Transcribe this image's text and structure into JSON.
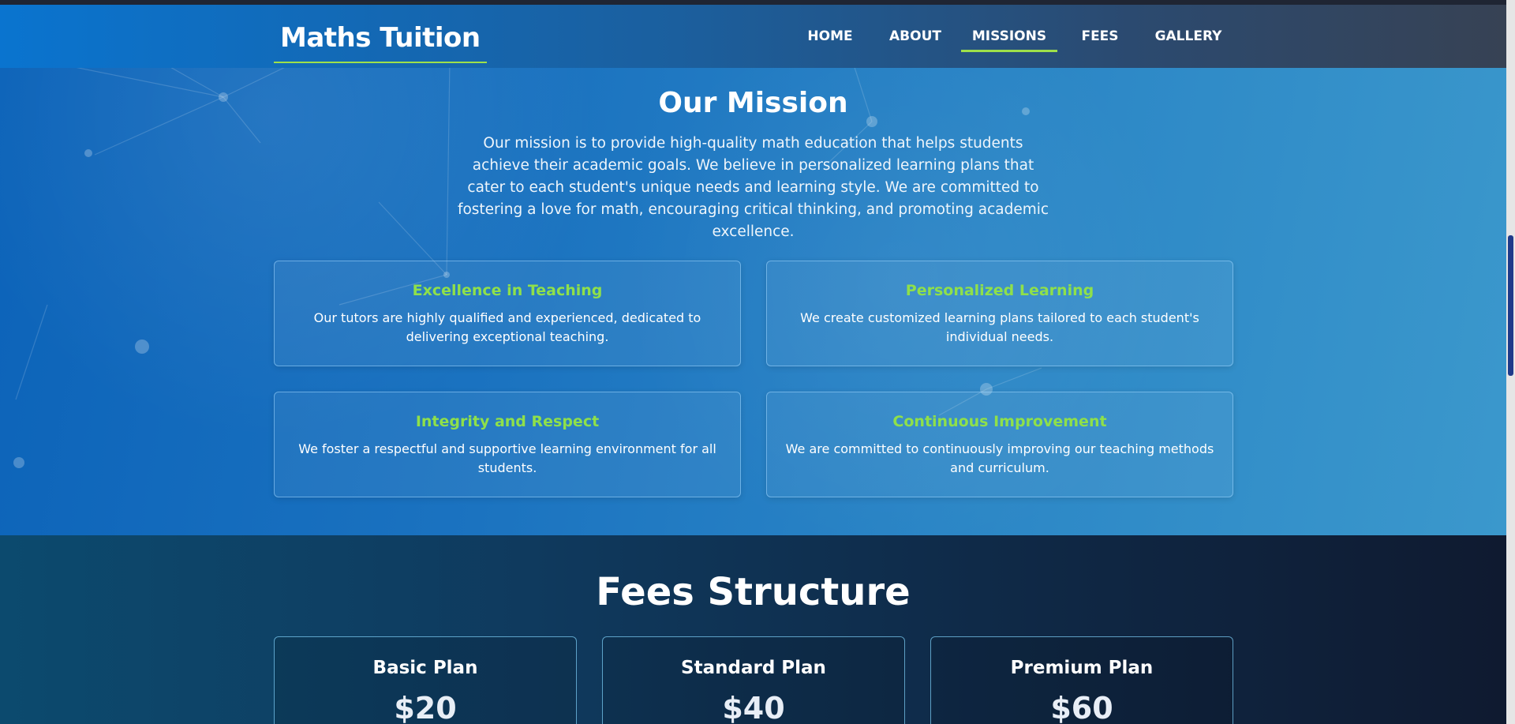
{
  "header": {
    "brand": "Maths Tuition",
    "nav": [
      {
        "label": "HOME"
      },
      {
        "label": "ABOUT"
      },
      {
        "label": "MISSIONS",
        "active": true
      },
      {
        "label": "FEES"
      },
      {
        "label": "GALLERY"
      }
    ]
  },
  "mission": {
    "title": "Our Mission",
    "text": "Our mission is to provide high-quality math education that helps students achieve their academic goals. We believe in personalized learning plans that cater to each student's unique needs and learning style. We are committed to fostering a love for math, encouraging critical thinking, and promoting academic excellence.",
    "cards": [
      {
        "title": "Excellence in Teaching",
        "text": "Our tutors are highly qualified and experienced, dedicated to delivering exceptional teaching."
      },
      {
        "title": "Personalized Learning",
        "text": "We create customized learning plans tailored to each student's individual needs."
      },
      {
        "title": "Integrity and Respect",
        "text": "We foster a respectful and supportive learning environment for all students."
      },
      {
        "title": "Continuous Improvement",
        "text": "We are committed to continuously improving our teaching methods and curriculum."
      }
    ]
  },
  "fees": {
    "title": "Fees Structure",
    "plans": [
      {
        "name": "Basic Plan",
        "price": "$20"
      },
      {
        "name": "Standard Plan",
        "price": "$40"
      },
      {
        "name": "Premium Plan",
        "price": "$60"
      }
    ]
  },
  "colors": {
    "accent": "#8fe04a",
    "header_start": "#0a74cf",
    "header_end": "#374254",
    "mission_bg": "#1b73c0",
    "fees_bg": "#0f2a48"
  }
}
